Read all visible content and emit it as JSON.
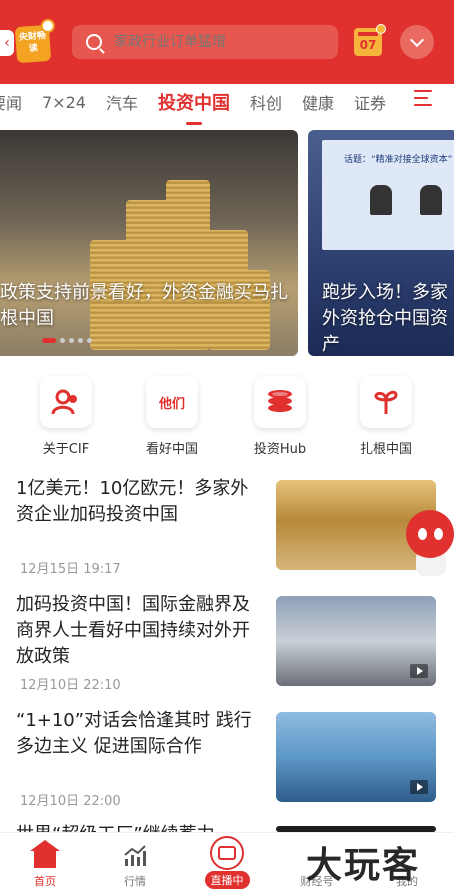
{
  "header": {
    "logo_text": "央财畅读",
    "search_placeholder": "家政行业订单猛增",
    "calendar_day": "07"
  },
  "tabs": [
    "要闻",
    "7×24",
    "汽车",
    "投资中国",
    "科创",
    "健康",
    "证券"
  ],
  "active_tab": "投资中国",
  "banners": [
    {
      "caption": "政策支持前景看好，外资金融买马扎根中国"
    },
    {
      "caption": "跑步入场！多家外资抢仓中国资产"
    }
  ],
  "banner_screen_title": "话题：“精准对接全球资本”",
  "quick_links": [
    {
      "label": "关于CIF",
      "icon": "people-icon"
    },
    {
      "label": "看好中国",
      "icon": "text-logo-icon",
      "icon_text": "他们"
    },
    {
      "label": "投资Hub",
      "icon": "coins-icon"
    },
    {
      "label": "扎根中国",
      "icon": "sprout-icon"
    }
  ],
  "news": [
    {
      "title": "1亿美元！10亿欧元！多家外资企业加码投资中国",
      "time": "12月15日 19:17"
    },
    {
      "title": "加码投资中国！国际金融界及商界人士看好中国持续对外开放政策",
      "time": "12月10日 22:10"
    },
    {
      "title": "“1+10”对话会恰逢其时 践行多边主义 促进国际合作",
      "time": "12月10日 22:00"
    },
    {
      "title": "世界“超级工厂”继续蓄力",
      "time": ""
    }
  ],
  "bottom_nav": [
    {
      "label": "首页",
      "icon": "home-icon",
      "active": true
    },
    {
      "label": "行情",
      "icon": "chart-trend-icon",
      "active": false
    },
    {
      "label": "直播中",
      "icon": "live-tv-icon",
      "active": false
    },
    {
      "label": "财经号",
      "icon": "finance-account-icon",
      "active": false
    },
    {
      "label": "我的",
      "icon": "profile-icon",
      "active": false
    }
  ],
  "watermark_text": "大玩客",
  "colors": {
    "brand_red": "#e0312f",
    "accent_orange": "#f3a221"
  }
}
